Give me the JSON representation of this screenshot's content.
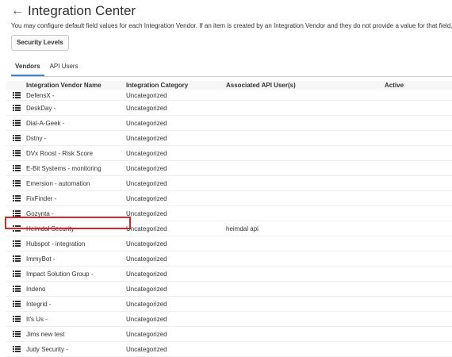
{
  "header": {
    "title": "Integration Center",
    "back_icon": "←"
  },
  "description": "You may configure default field values for each Integration Vendor. If an item is created by an Integration Vendor and they do not provide a value for that field, the defau",
  "buttons": {
    "security_levels": "Security Levels"
  },
  "tabs": [
    {
      "label": "Vendors",
      "active": true
    },
    {
      "label": "API Users",
      "active": false
    }
  ],
  "table": {
    "columns": [
      "Integration Vendor Name",
      "Integration Category",
      "Associated API User(s)",
      "Active"
    ],
    "rows": [
      {
        "name": "DefensX -",
        "category": "Uncategorized",
        "api_user": "",
        "active": ""
      },
      {
        "name": "DeskDay -",
        "category": "Uncategorized",
        "api_user": "",
        "active": ""
      },
      {
        "name": "Dial-A-Geek -",
        "category": "Uncategorized",
        "api_user": "",
        "active": ""
      },
      {
        "name": "Dstny -",
        "category": "Uncategorized",
        "api_user": "",
        "active": ""
      },
      {
        "name": "DVx Roost - Risk Score",
        "category": "Uncategorized",
        "api_user": "",
        "active": ""
      },
      {
        "name": "E-Bit Systems - monitoring",
        "category": "Uncategorized",
        "api_user": "",
        "active": ""
      },
      {
        "name": "Emersion - automation",
        "category": "Uncategorized",
        "api_user": "",
        "active": ""
      },
      {
        "name": "FixFinder -",
        "category": "Uncategorized",
        "api_user": "",
        "active": ""
      },
      {
        "name": "Gozynta -",
        "category": "Uncategorized",
        "api_user": "",
        "active": ""
      },
      {
        "name": "Heimdal Security -",
        "category": "Uncategorized",
        "api_user": "heimdal api",
        "active": ""
      },
      {
        "name": "Hubspot - integration",
        "category": "Uncategorized",
        "api_user": "",
        "active": ""
      },
      {
        "name": "ImmyBot -",
        "category": "Uncategorized",
        "api_user": "",
        "active": ""
      },
      {
        "name": "Impact Solution Group -",
        "category": "Uncategorized",
        "api_user": "",
        "active": ""
      },
      {
        "name": "Indeno",
        "category": "Uncategorized",
        "api_user": "",
        "active": ""
      },
      {
        "name": "Integrid -",
        "category": "Uncategorized",
        "api_user": "",
        "active": ""
      },
      {
        "name": "It's Us -",
        "category": "Uncategorized",
        "api_user": "",
        "active": ""
      },
      {
        "name": "Jims new test",
        "category": "Uncategorized",
        "api_user": "",
        "active": ""
      },
      {
        "name": "Judy Security -",
        "category": "Uncategorized",
        "api_user": "",
        "active": ""
      }
    ]
  },
  "colors": {
    "accent": "#4a80c8",
    "highlight": "#d8262a"
  },
  "icons": {
    "row_icon": "list-icon",
    "back": "back-arrow-icon"
  }
}
